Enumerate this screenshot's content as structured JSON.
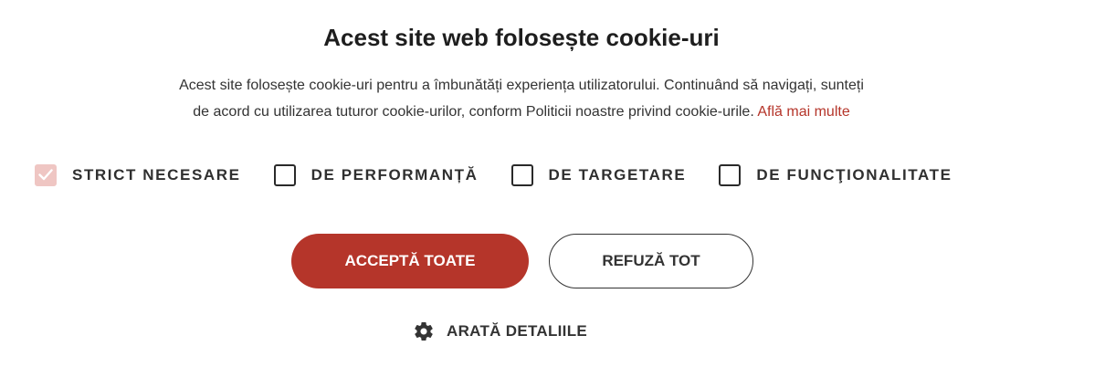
{
  "banner": {
    "title": "Acest site web folosește cookie-uri",
    "description_line1": "Acest site folosește cookie-uri pentru a îmbunătăți experiența utilizatorului. Continuând să navigați, sunteți",
    "description_line2": "de acord cu utilizarea tuturor cookie-urilor, conform Politicii noastre privind cookie-urile.",
    "learn_more": "Află mai multe"
  },
  "categories": [
    {
      "label": "STRICT NECESARE",
      "checked": true,
      "disabled": true
    },
    {
      "label": "DE PERFORMANȚĂ",
      "checked": false,
      "disabled": false
    },
    {
      "label": "DE TARGETARE",
      "checked": false,
      "disabled": false
    },
    {
      "label": "DE FUNCŢIONALITATE",
      "checked": false,
      "disabled": false
    }
  ],
  "buttons": {
    "accept_all": "ACCEPTĂ TOATE",
    "refuse_all": "REFUZĂ TOT"
  },
  "details": {
    "label": "ARATĂ DETALIILE",
    "icon": "gear-icon"
  },
  "colors": {
    "accent": "#b5352a",
    "checkbox_disabled": "#efc6c3",
    "text": "#333333"
  }
}
